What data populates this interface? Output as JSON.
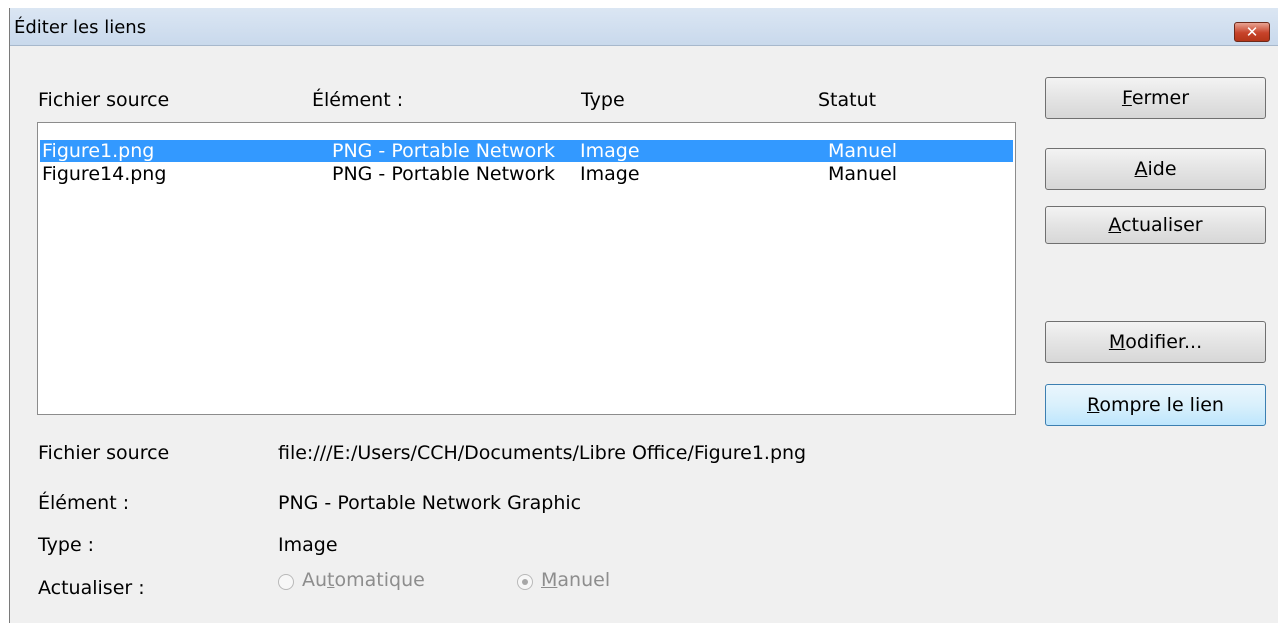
{
  "dialog": {
    "title": "Éditer les liens",
    "close_glyph": "✕"
  },
  "columns": {
    "source": "Fichier source",
    "element": "Élément :",
    "type": "Type",
    "status": "Statut"
  },
  "links": [
    {
      "source": "Figure1.png",
      "element": "PNG - Portable Network",
      "type": "Image",
      "status": "Manuel",
      "selected": true
    },
    {
      "source": "Figure14.png",
      "element": "PNG - Portable Network",
      "type": "Image",
      "status": "Manuel",
      "selected": false
    }
  ],
  "buttons": {
    "close": {
      "first": "F",
      "rest": "ermer"
    },
    "help": {
      "first": "A",
      "rest": "ide"
    },
    "update": {
      "first": "A",
      "rest": "ctualiser"
    },
    "modify": {
      "first": "M",
      "rest": "odifier..."
    },
    "break": {
      "first": "R",
      "rest": "ompre le lien"
    }
  },
  "details": {
    "source_label": "Fichier source",
    "source_value": "file:///E:/Users/CCH/Documents/Libre Office/Figure1.png",
    "element_label": "Élément :",
    "element_value": "PNG - Portable Network Graphic",
    "type_label": "Type :",
    "type_value": "Image",
    "update_label": "Actualiser :"
  },
  "update_mode": {
    "automatic": {
      "pre": "Au",
      "ul": "t",
      "post": "omatique",
      "selected": false,
      "enabled": false
    },
    "manual": {
      "pre": "",
      "ul": "M",
      "post": "anuel",
      "selected": true,
      "enabled": false
    }
  }
}
